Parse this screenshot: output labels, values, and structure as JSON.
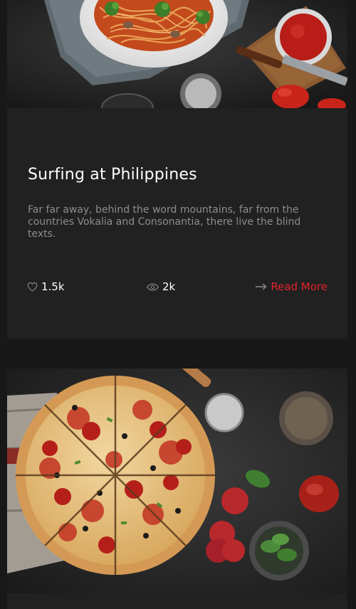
{
  "posts": [
    {
      "title": "Surfing at Philippines",
      "excerpt": "Far far away, behind the word mountains, far from the countries Vokalia and Consonantia, there live the blind texts.",
      "likes": "1.5k",
      "views": "2k",
      "read_more": "Read More",
      "icons": {
        "likes": "heart-icon",
        "views": "eye-icon",
        "read_more": "arrow-right-icon"
      },
      "image": "spaghetti-dish-photo"
    },
    {
      "image": "pizza-photo"
    }
  ],
  "colors": {
    "page_background": "#181818",
    "card_background": "#212121",
    "title": "#ffffff",
    "excerpt": "#8c8c8c",
    "accent": "#e2222b"
  }
}
